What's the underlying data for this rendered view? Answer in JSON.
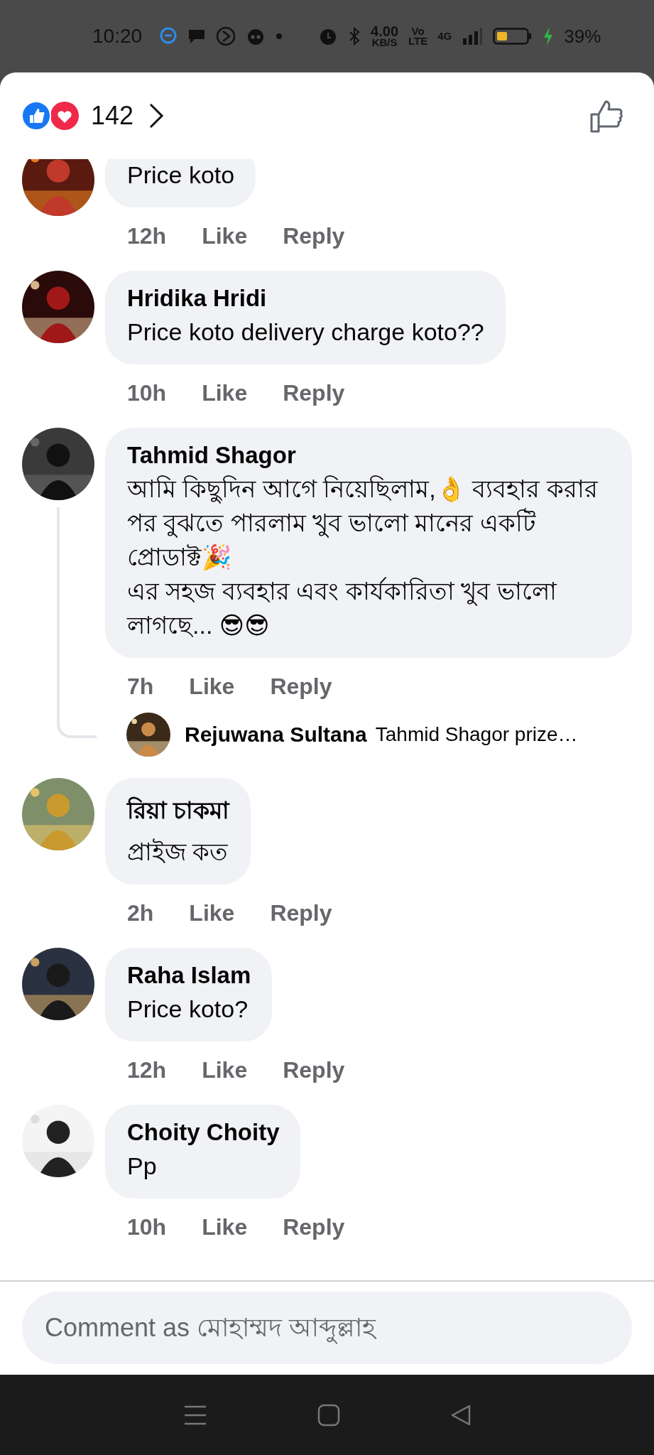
{
  "status_bar": {
    "time": "10:20",
    "speed": "4.00",
    "speed_unit": "KB/S",
    "volte_top": "Vo",
    "volte_bottom": "LTE",
    "network": "4G",
    "battery": "39%"
  },
  "reactions": {
    "count": "142"
  },
  "comments": [
    {
      "kind": "cut",
      "text": "Price koto",
      "time": "12h",
      "like": "Like",
      "reply": "Reply"
    },
    {
      "kind": "full",
      "name": "Hridika Hridi",
      "text": "Price koto delivery charge koto??",
      "time": "10h",
      "like": "Like",
      "reply": "Reply"
    },
    {
      "kind": "full",
      "name": "Tahmid Shagor",
      "text": "আমি কিছুদিন আগে নিয়েছিলাম,👌 ব্যবহার করার পর বুঝতে পারলাম খুব ভালো মানের একটি প্রোডাক্ট🎉\nএর সহজ ব্যবহার এবং কার্যকারিতা খুব ভালো লাগছে... 😎😎",
      "time": "7h",
      "like": "Like",
      "reply": "Reply",
      "replies": [
        {
          "name": "Rejuwana Sultana",
          "text": "Tahmid Shagor prize…"
        }
      ]
    },
    {
      "kind": "full",
      "name": "রিয়া চাকমা",
      "text": "প্রাইজ কত",
      "time": "2h",
      "like": "Like",
      "reply": "Reply"
    },
    {
      "kind": "full",
      "name": "Raha Islam",
      "text": "Price koto?",
      "time": "12h",
      "like": "Like",
      "reply": "Reply"
    },
    {
      "kind": "full",
      "name": "Choity Choity",
      "text": "Pp",
      "time": "10h",
      "like": "Like",
      "reply": "Reply"
    }
  ],
  "composer": {
    "placeholder": "Comment as মোহাম্মদ আব্দুল্লাহ"
  }
}
